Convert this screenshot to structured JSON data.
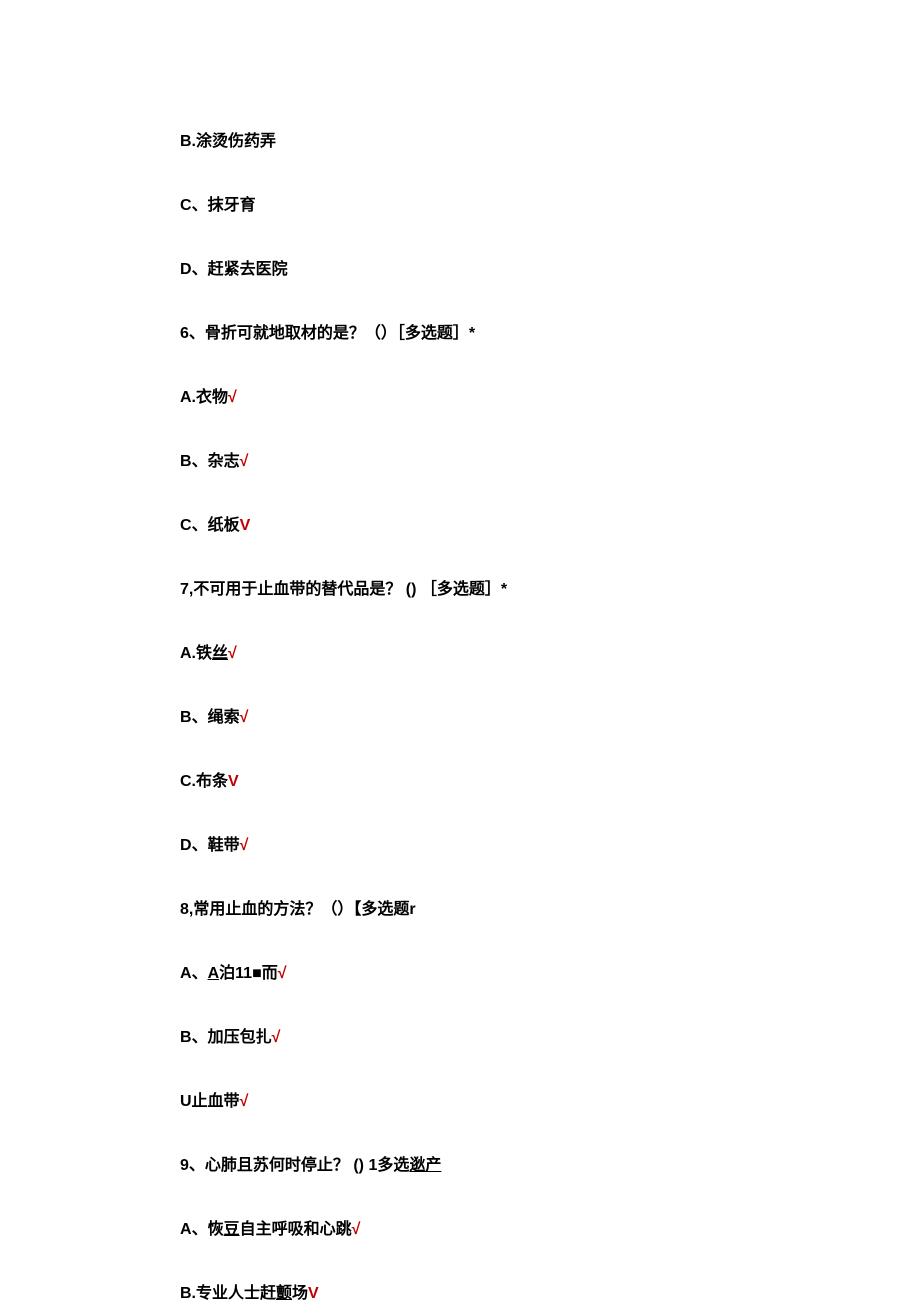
{
  "lines": [
    {
      "bold": "B.",
      "text": "涂烫伤药弄",
      "mark": ""
    },
    {
      "bold": "C",
      "text": "、抹牙育",
      "mark": ""
    },
    {
      "bold": "D",
      "text": "、赶紧去医院",
      "mark": ""
    },
    {
      "bold": "6",
      "text": "、骨折可就地取材的是？（）［多选题］*",
      "mark": ""
    },
    {
      "bold": "A.",
      "text": "衣物",
      "mark": "√"
    },
    {
      "bold": "B",
      "text": "、杂志",
      "mark": "√"
    },
    {
      "bold": "C",
      "text": "、纸板",
      "mark": "V"
    },
    {
      "bold": "7,",
      "text": "不可用于止血带的替代品是？ () ［多选题］*",
      "mark": ""
    },
    {
      "bold": "A.",
      "text": "铁",
      "underline": "丝",
      "mark": "√"
    },
    {
      "bold": "B",
      "text": "、绳索",
      "mark": "√"
    },
    {
      "bold": "C.",
      "text": "布条",
      "mark": "V"
    },
    {
      "bold": "D",
      "text": "、鞋带",
      "mark": "√"
    },
    {
      "bold": "8,",
      "text": "常用止血的方法？（）【多选题",
      "mark": "",
      "trail": "r"
    },
    {
      "bold": "A",
      "text": "、",
      "underline": "A",
      "text2": "泊",
      "bold2": "11■",
      "text3": "而",
      "mark": "√"
    },
    {
      "bold": "B",
      "text": "、加压包扎",
      "mark": "√"
    },
    {
      "bold": "",
      "text": "U止血带",
      "mark": "√"
    },
    {
      "bold": "9",
      "text": "、心肺且苏何时停止？ () 1多选",
      "underline": "逖产",
      "mark": ""
    },
    {
      "bold": "A",
      "text": "、恢",
      "underline": "豆",
      "text2": "自主呼吸和心跳",
      "mark": "√"
    },
    {
      "bold": "B.",
      "text": "专业人士赶",
      "underline": "颤",
      "text2": "场",
      "mark": "V"
    }
  ]
}
